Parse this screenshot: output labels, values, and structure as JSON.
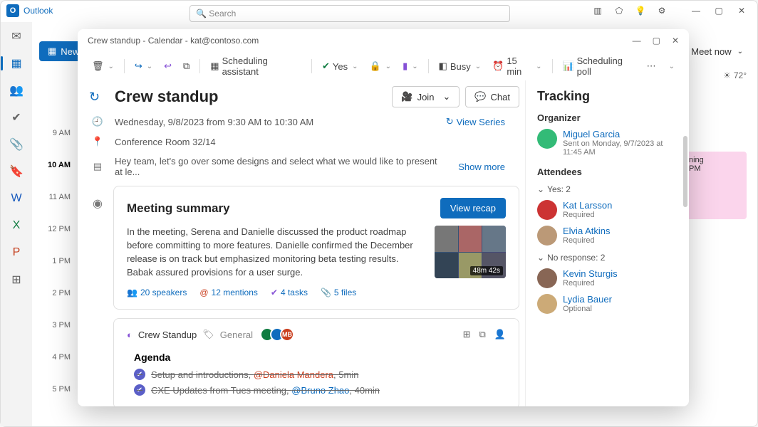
{
  "app": {
    "name": "Outlook"
  },
  "search": {
    "placeholder": "Search"
  },
  "topcmd": {
    "new": "New",
    "meetnow": "Meet now"
  },
  "weather": {
    "temp": "72°"
  },
  "pinkblock": {
    "l1": "ning",
    "l2": "PM"
  },
  "timeslots": [
    "9 AM",
    "10 AM",
    "11 AM",
    "12 PM",
    "1 PM",
    "2 PM",
    "3 PM",
    "4 PM",
    "5 PM"
  ],
  "dialog": {
    "title": "Crew standup - Calendar - kat@contoso.com",
    "toolbar": {
      "sched": "Scheduling assistant",
      "yes": "Yes",
      "busy": "Busy",
      "remind": "15 min",
      "poll": "Scheduling poll"
    },
    "event": {
      "title": "Crew standup",
      "join": "Join",
      "chat": "Chat",
      "datetime": "Wednesday, 9/8/2023 from 9:30 AM to 10:30 AM",
      "viewseries": "View Series",
      "location": "Conference Room 32/14",
      "preview": "Hey team, let's go over some designs and select what we would like to present at le...",
      "showmore": "Show more"
    },
    "summary": {
      "heading": "Meeting summary",
      "recap": "View recap",
      "text": "In the meeting, Serena and Danielle discussed the product roadmap before committing to more features. Danielle confirmed the December release is on track but emphasized monitoring beta testing results. Babak assured provisions for a user surge.",
      "duration": "48m 42s",
      "stats": {
        "speakers": "20 speakers",
        "mentions": "12 mentions",
        "tasks": "4 tasks",
        "files": "5 files"
      }
    },
    "loop": {
      "name": "Crew Standup",
      "tag": "General",
      "av3": "MB",
      "agenda_heading": "Agenda",
      "items": [
        {
          "text": "Setup and introductions, ",
          "mention": "@Daniela Mandera",
          "tail": ", 5min"
        },
        {
          "text": "CXE Updates from Tues meeting, ",
          "mention": "@Bruno Zhao",
          "tail": ", 40min"
        }
      ]
    }
  },
  "tracking": {
    "heading": "Tracking",
    "organizer_label": "Organizer",
    "organizer": {
      "name": "Miguel Garcia",
      "sent": "Sent on Monday, 9/7/2023 at 11:45 AM"
    },
    "attendees_label": "Attendees",
    "yes": "Yes: 2",
    "noresp": "No response: 2",
    "people": [
      {
        "name": "Kat Larsson",
        "detail": "Required"
      },
      {
        "name": "Elvia Atkins",
        "detail": "Required"
      },
      {
        "name": "Kevin Sturgis",
        "detail": "Required"
      },
      {
        "name": "Lydia Bauer",
        "detail": "Optional"
      }
    ]
  }
}
